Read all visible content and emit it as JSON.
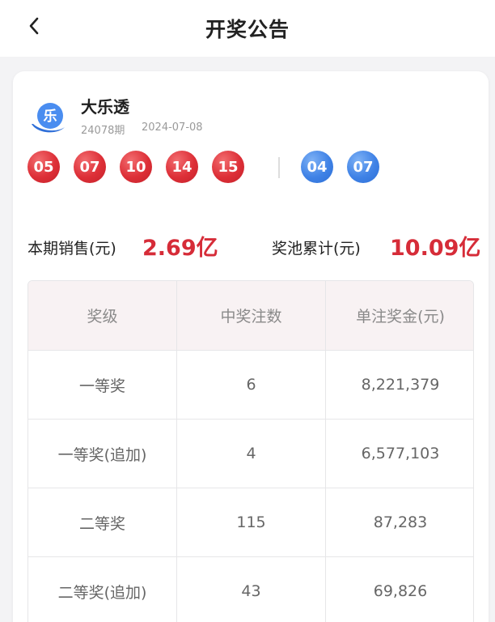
{
  "header": {
    "title": "开奖公告"
  },
  "lottery": {
    "logo_char": "乐",
    "name": "大乐透",
    "issue": "24078期",
    "date": "2024-07-08",
    "red_balls": [
      "05",
      "07",
      "10",
      "14",
      "15"
    ],
    "blue_balls": [
      "04",
      "07"
    ]
  },
  "summary": {
    "sales_label": "本期销售(元)",
    "sales_value": "2.69亿",
    "pool_label": "奖池累计(元)",
    "pool_value": "10.09亿"
  },
  "prize_table": {
    "headers": [
      "奖级",
      "中奖注数",
      "单注奖金(元)"
    ],
    "rows": [
      [
        "一等奖",
        "6",
        "8,221,379"
      ],
      [
        "一等奖(追加)",
        "4",
        "6,577,103"
      ],
      [
        "二等奖",
        "115",
        "87,283"
      ],
      [
        "二等奖(追加)",
        "43",
        "69,826"
      ]
    ]
  },
  "colors": {
    "accent_red": "#d62c38",
    "ball_red": "#dd2f37",
    "ball_blue": "#3f82e6",
    "logo_blue": "#4a8df0"
  }
}
